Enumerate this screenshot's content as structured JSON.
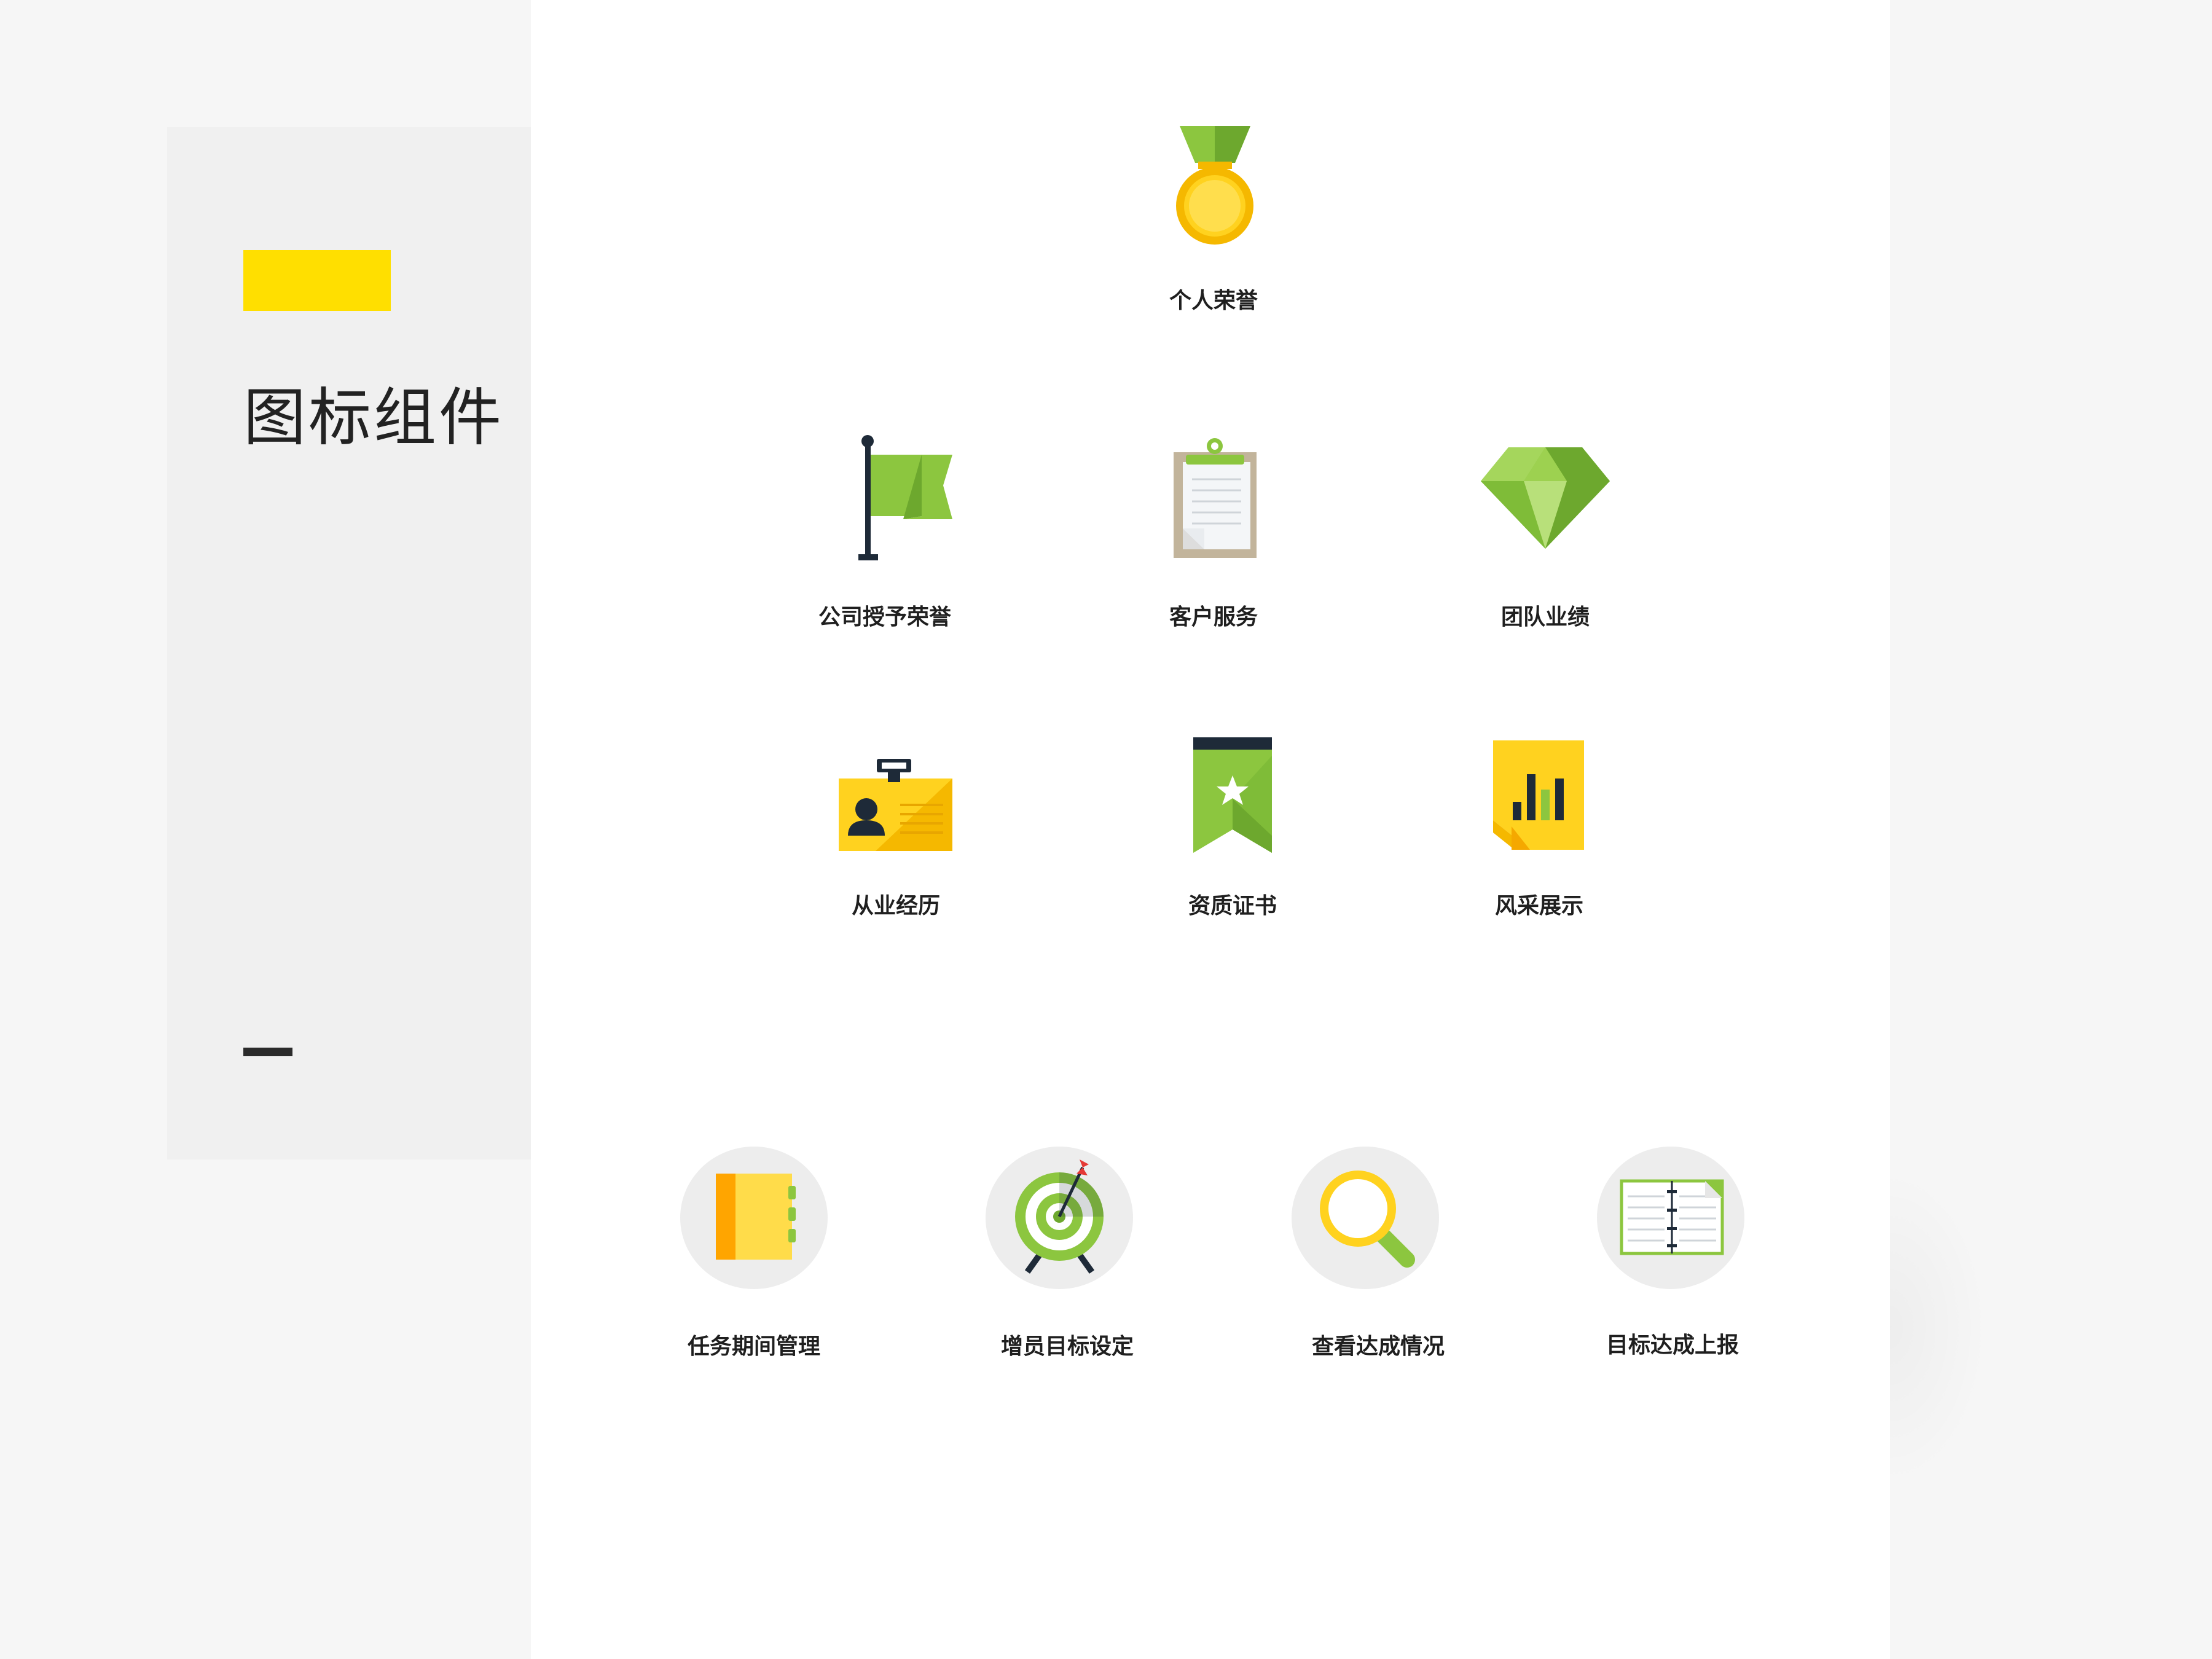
{
  "sidebar": {
    "title": "图标组件"
  },
  "icons": {
    "personal_honor": "个人荣誉",
    "company_honor": "公司授予荣誉",
    "customer_service": "客户服务",
    "team_performance": "团队业绩",
    "work_history": "从业经历",
    "qualification": "资质证书",
    "showcase": "风采展示",
    "task_period": "任务期间管理",
    "recruit_goal": "增员目标设定",
    "view_progress": "查看达成情况",
    "goal_report": "目标达成上报"
  },
  "icon_names": [
    "medal-icon",
    "flag-icon",
    "clipboard-icon",
    "diamond-icon",
    "id-badge-icon",
    "certificate-ribbon-icon",
    "bar-chart-note-icon",
    "notebook-icon",
    "target-icon",
    "magnifier-icon",
    "open-book-icon"
  ],
  "colors": {
    "accent_yellow": "#ffdf00",
    "green": "#8cc63f",
    "dark_navy": "#1e2a38"
  }
}
